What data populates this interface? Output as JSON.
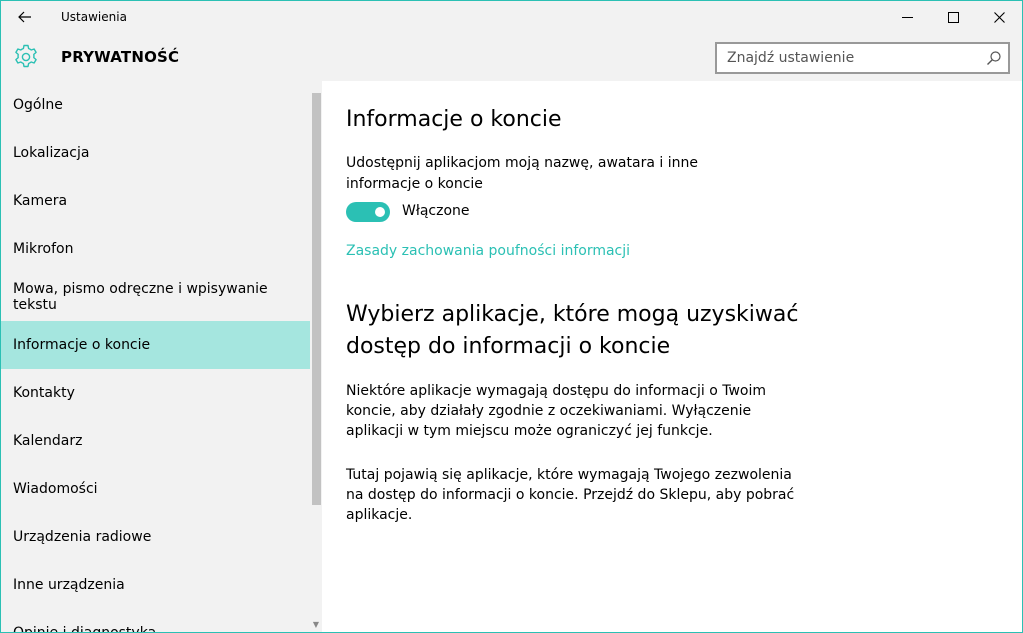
{
  "window": {
    "title": "Ustawienia",
    "accent_color": "#2bc0b4",
    "selected_color": "#a5e6df"
  },
  "titlebar": {
    "back_icon": "back-arrow-icon",
    "minimize_icon": "minimize-icon",
    "maximize_icon": "maximize-icon",
    "close_icon": "close-icon"
  },
  "header": {
    "icon": "gear-icon",
    "title": "PRYWATNOŚĆ"
  },
  "search": {
    "placeholder": "Znajdź ustawienie",
    "value": "",
    "icon": "search-icon"
  },
  "sidebar": {
    "selected_index": 5,
    "items": [
      {
        "label": "Ogólne"
      },
      {
        "label": "Lokalizacja"
      },
      {
        "label": "Kamera"
      },
      {
        "label": "Mikrofon"
      },
      {
        "label": "Mowa, pismo odręczne i wpisywanie tekstu"
      },
      {
        "label": "Informacje o koncie"
      },
      {
        "label": "Kontakty"
      },
      {
        "label": "Kalendarz"
      },
      {
        "label": "Wiadomości"
      },
      {
        "label": "Urządzenia radiowe"
      },
      {
        "label": "Inne urządzenia"
      },
      {
        "label": "Opinie i diagnostyka"
      }
    ]
  },
  "main": {
    "heading": "Informacje o koncie",
    "description": "Udostępnij aplikacjom moją nazwę, awatara i inne informacje o koncie",
    "toggle": {
      "state": "on",
      "label": "Włączone"
    },
    "privacy_link": "Zasady zachowania poufności informacji",
    "subheading": "Wybierz aplikacje, które mogą uzyskiwać dostęp do informacji o koncie",
    "paragraph1": "Niektóre aplikacje wymagają dostępu do informacji o Twoim koncie, aby działały zgodnie z oczekiwaniami. Wyłączenie aplikacji w tym miejscu może ograniczyć jej funkcje.",
    "paragraph2": "Tutaj pojawią się aplikacje, które wymagają Twojego zezwolenia na dostęp do informacji o koncie. Przejdź do Sklepu, aby pobrać aplikacje."
  }
}
